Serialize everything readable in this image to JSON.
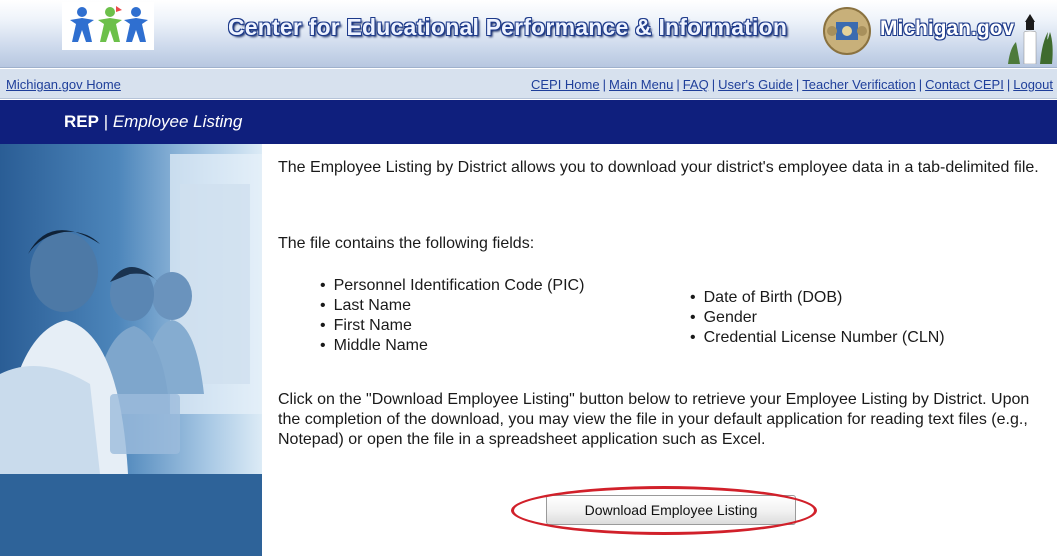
{
  "header": {
    "title": "Center for Educational Performance & Information",
    "state_logo_text": "Michigan.gov"
  },
  "nav": {
    "home": "Michigan.gov Home",
    "links": [
      "CEPI Home",
      "Main Menu",
      "FAQ",
      "User's Guide",
      "Teacher Verification",
      "Contact CEPI",
      "Logout"
    ],
    "separator": "|"
  },
  "page_title": {
    "section": "REP",
    "separator": " | ",
    "name": "Employee Listing"
  },
  "content": {
    "intro": "The Employee Listing by District allows you to download your district's employee data in a tab-delimited file.",
    "fields_intro": "The file contains the following fields:",
    "fields_col1": [
      "Personnel Identification Code (PIC)",
      "Last Name",
      "First Name",
      "Middle Name"
    ],
    "fields_col2": [
      "Date of Birth (DOB)",
      "Gender",
      "Credential License Number (CLN)"
    ],
    "instructions": "Click on the \"Download Employee Listing\" button below to retrieve your Employee Listing by District. Upon the completion of the download, you may view the file in your default application for reading text files (e.g., Notepad) or open the file in a spreadsheet application such as Excel.",
    "download_button": "Download Employee Listing"
  },
  "colors": {
    "title_bar": "#0f1f7d",
    "nav_bar": "#d7e1ee",
    "link": "#1f3f9a",
    "highlight_ring": "#d1202a"
  }
}
